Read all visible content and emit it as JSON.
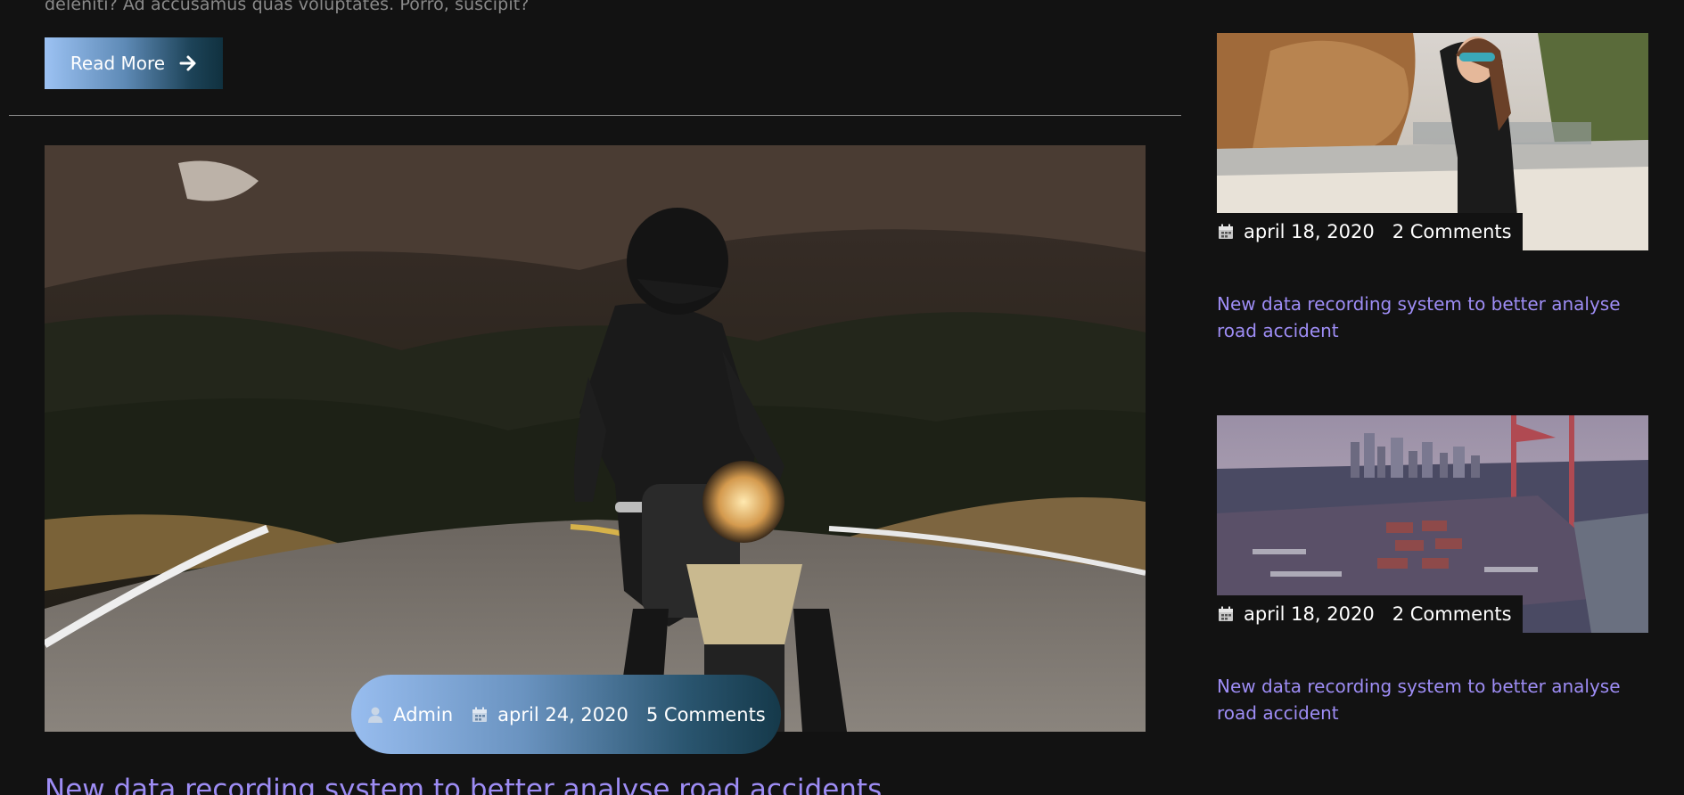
{
  "previous_post": {
    "excerpt_tail": "deleniti? Ad accusamus quas voluptates. Porro, suscipit?",
    "read_more_label": "Read More",
    "read_more_icon": "arrow-right-icon"
  },
  "featured_post": {
    "image_alt": "Rider on a motorcycle on a mountain road",
    "author": "Admin",
    "date": "april 24, 2020",
    "comments": "5 Comments",
    "title": "New data recording system to better analyse road accidents"
  },
  "sidebar": {
    "posts": [
      {
        "date": "april 18, 2020",
        "comments": "2 Comments",
        "title": "New data recording system to better analyse road accident"
      },
      {
        "date": "april 18, 2020",
        "comments": "2 Comments",
        "title": "New data recording system to better analyse road accident"
      }
    ]
  },
  "colors": {
    "background": "#121212",
    "link": "#9e8df5",
    "gradient_start": "#9cc2f3",
    "gradient_end": "#10313f"
  }
}
